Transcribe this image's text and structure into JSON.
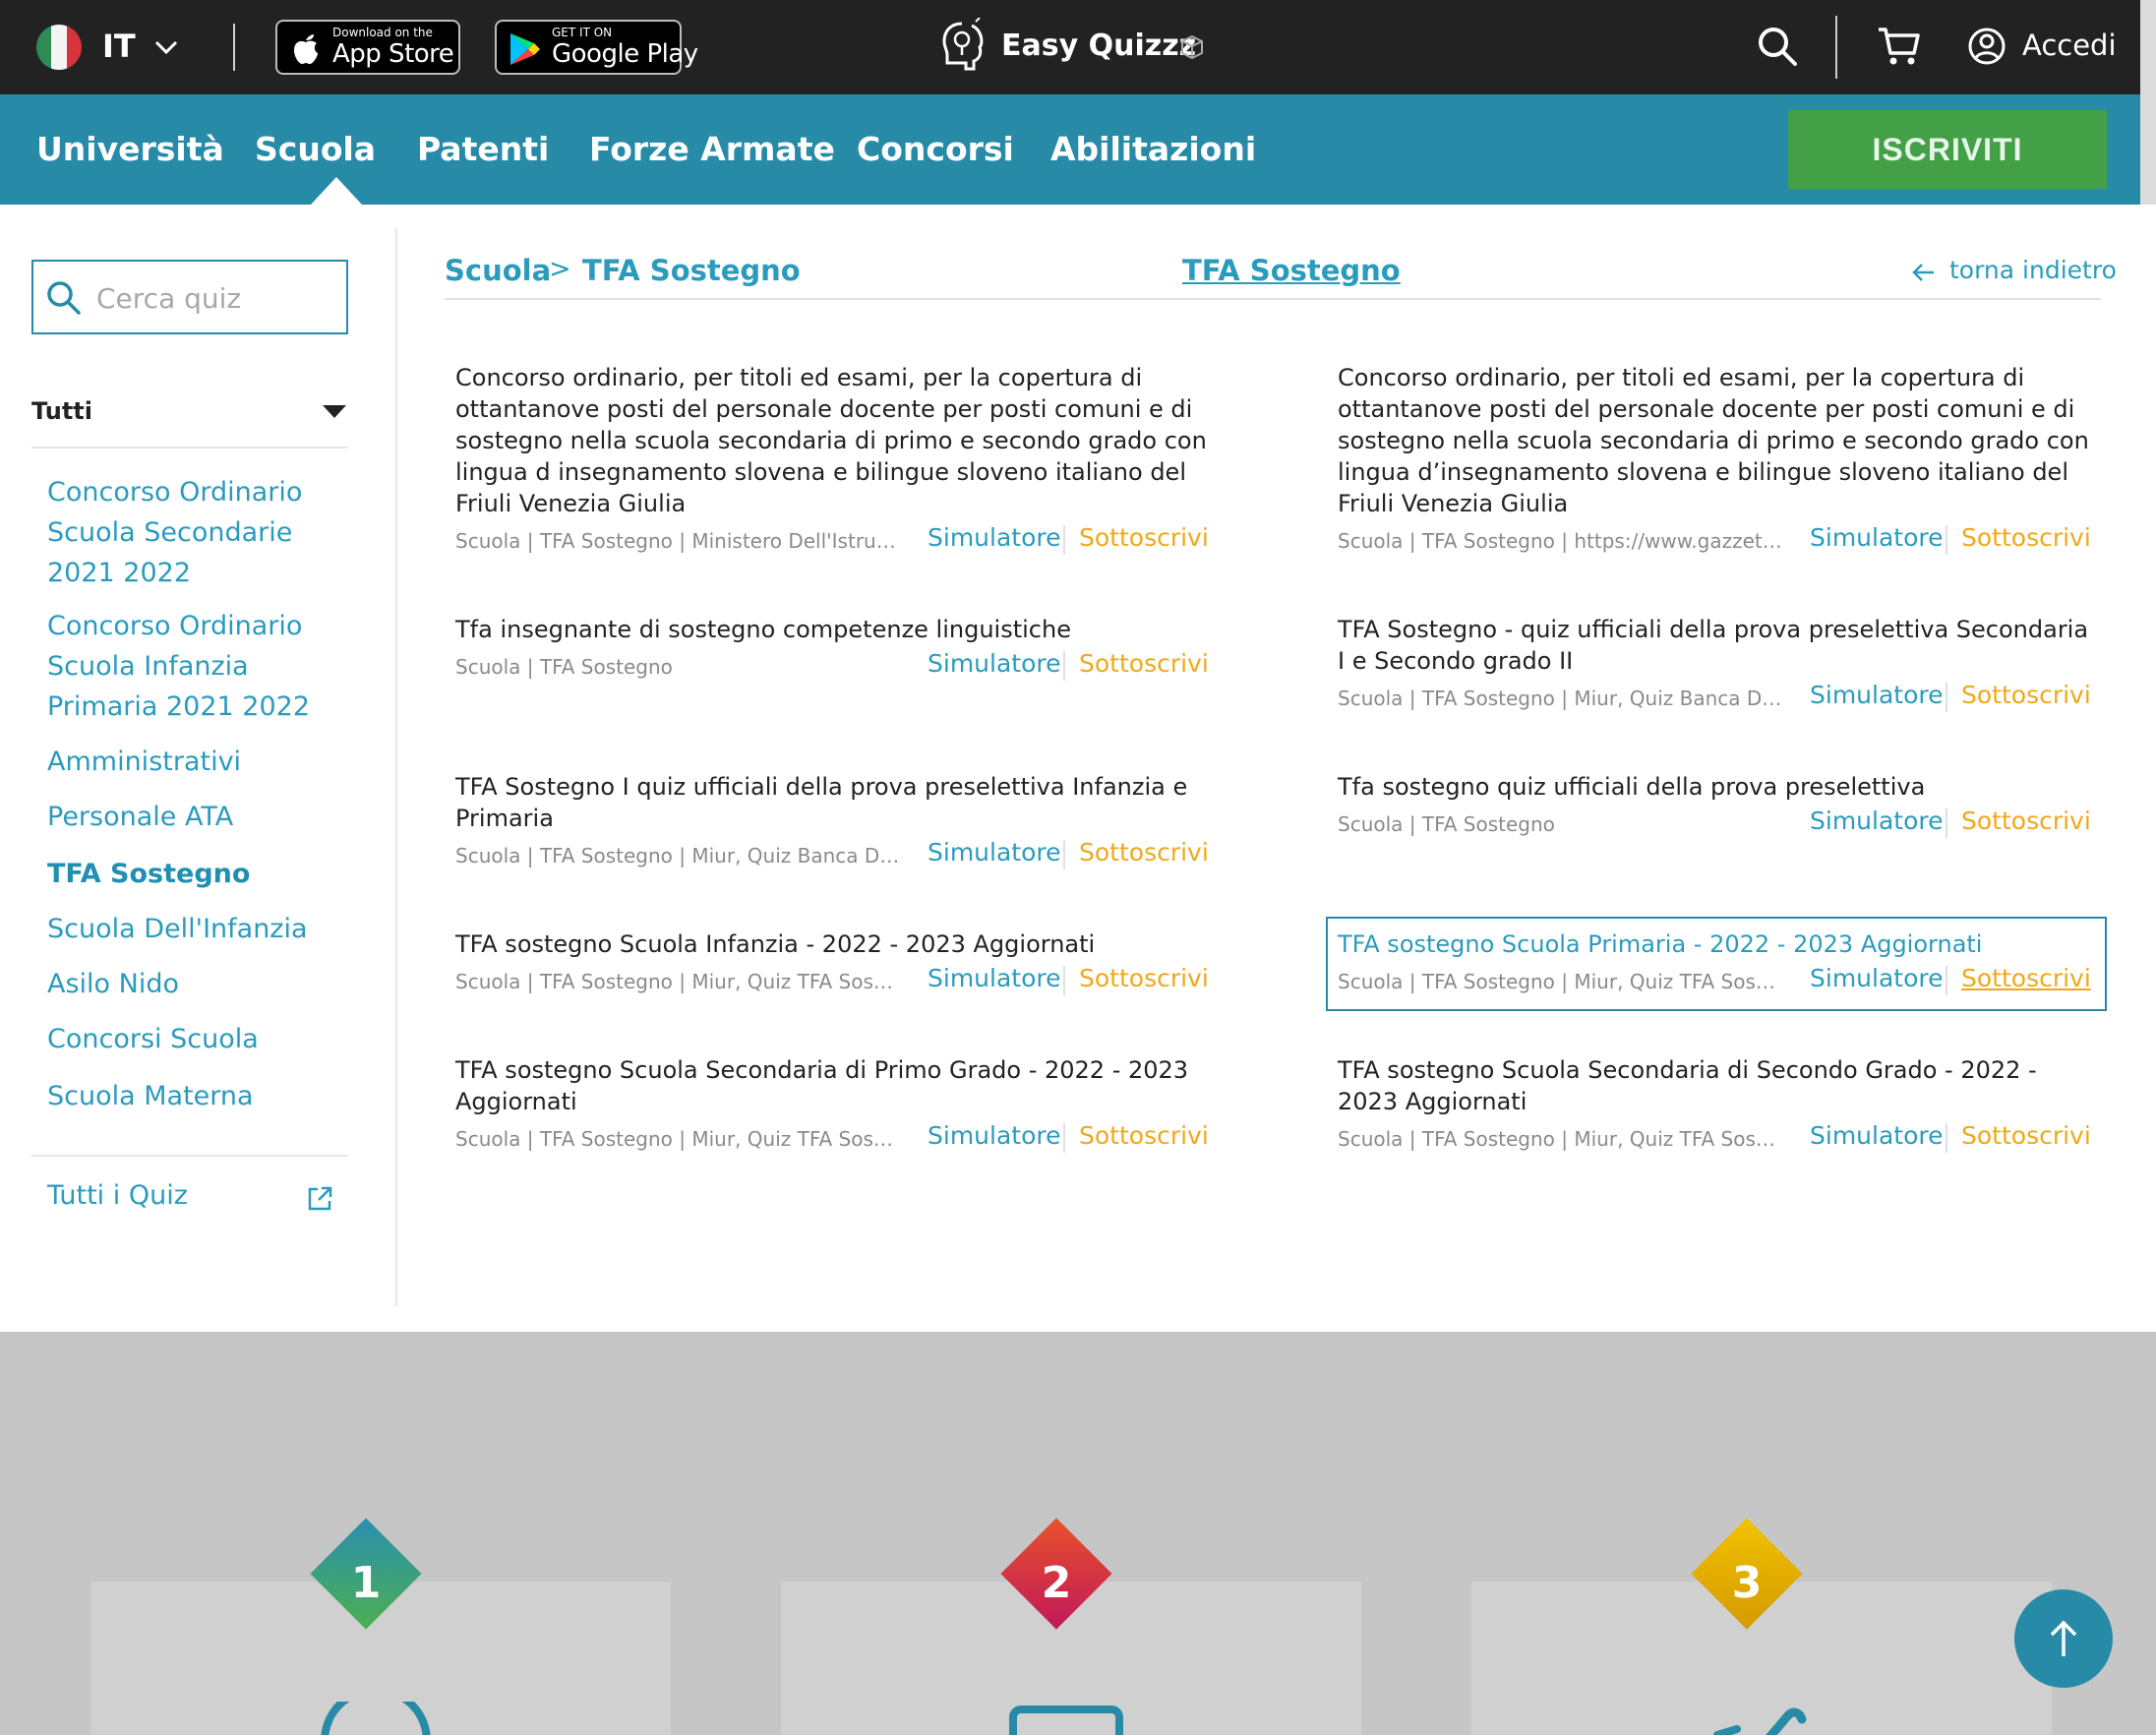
{
  "header": {
    "language": "IT",
    "app_store": {
      "small": "Download on the",
      "big": "App Store"
    },
    "google_play": {
      "small": "GET IT ON",
      "big": "Google Play"
    },
    "brand": "Easy Quizzz",
    "login": "Accedi"
  },
  "nav": {
    "items": [
      "Università",
      "Scuola",
      "Patenti",
      "Forze Armate",
      "Concorsi",
      "Abilitazioni"
    ],
    "active": "Scuola",
    "signup": "ISCRIVITI"
  },
  "sidebar": {
    "search_placeholder": "Cerca quiz",
    "filter": "Tutti",
    "links": [
      "Concorso Ordinario Scuola Secondarie 2021 2022",
      "Concorso Ordinario Scuola Infanzia Primaria 2021 2022",
      "Amministrativi",
      "Personale ATA",
      "TFA Sostegno",
      "Scuola Dell'Infanzia",
      "Asilo Nido",
      "Concorsi Scuola",
      "Scuola Materna"
    ],
    "active_link": "TFA Sostegno",
    "all_quiz": "Tutti i Quiz"
  },
  "main": {
    "breadcrumb": [
      "Scuola",
      "TFA Sostegno"
    ],
    "breadcrumb_sep": ">",
    "title": "TFA Sostegno",
    "back": "torna indietro",
    "action_simulator": "Simulatore",
    "action_subscribe": "Sottoscrivi",
    "quizzes": [
      {
        "title": "Concorso ordinario, per titoli ed esami, per la copertura di ottantanove posti del personale docente per posti comuni e di sostegno nella scuola secondaria di primo e secondo grado con lingua d insegnamento slovena e bilingue sloveno italiano del Friuli Venezia Giulia",
        "meta": "Scuola | TFA Sostegno | Ministero Dell'Istruzi..."
      },
      {
        "title": "Concorso ordinario, per titoli ed esami, per la copertura di ottantanove posti del personale docente per posti comuni e di sostegno nella scuola secondaria di primo e secondo grado con lingua d’insegnamento slovena e bilingue sloveno italiano del Friuli Venezia Giulia",
        "meta": "Scuola | TFA Sostegno | https://www.gazzetta..."
      },
      {
        "title": "Tfa insegnante di sostegno competenze linguistiche",
        "meta": "Scuola | TFA Sostegno"
      },
      {
        "title": "TFA Sostegno - quiz ufficiali della prova preselettiva Secondaria I e Secondo grado II",
        "meta": "Scuola | TFA Sostegno | Miur, Quiz Banca Dati..."
      },
      {
        "title": "TFA Sostegno I quiz ufficiali della prova preselettiva Infanzia e Primaria",
        "meta": "Scuola | TFA Sostegno | Miur, Quiz Banca Dati..."
      },
      {
        "title": "Tfa sostegno quiz ufficiali della prova preselettiva",
        "meta": "Scuola | TFA Sostegno"
      },
      {
        "title": "TFA sostegno Scuola Infanzia - 2022 - 2023 Aggiornati",
        "meta": "Scuola | TFA Sostegno | Miur, Quiz TFA Sosteg..."
      },
      {
        "title": "TFA sostegno Scuola Primaria - 2022 - 2023 Aggiornati",
        "meta": "Scuola | TFA Sostegno | Miur, Quiz TFA Sosteg..."
      },
      {
        "title": "TFA sostegno Scuola Secondaria di Primo Grado - 2022 - 2023 Aggiornati",
        "meta": "Scuola | TFA Sostegno | Miur, Quiz TFA Sosteg..."
      },
      {
        "title": "TFA sostegno Scuola Secondaria di Secondo Grado - 2022 - 2023 Aggiornati",
        "meta": "Scuola | TFA Sostegno | Miur, Quiz TFA Sosteg..."
      }
    ],
    "highlighted_quiz": "TFA sostegno Scuola Primaria - 2022 - 2023 Aggiornati"
  },
  "features": {
    "steps": [
      "1",
      "2",
      "3"
    ],
    "colors": [
      "#2e9e7a",
      "#d7264a",
      "#e0a800"
    ]
  },
  "colors": {
    "topbar": "#222222",
    "nav": "#278ba8",
    "signup": "#43a047",
    "link": "#2a9bbd",
    "subscribe": "#f0a81a"
  }
}
